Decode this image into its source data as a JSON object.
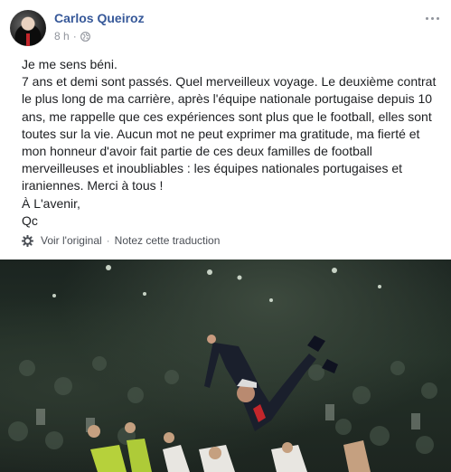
{
  "post": {
    "author": "Carlos Queiroz",
    "time": "8 h",
    "dot": "·",
    "paragraphs": [
      "Je me sens béni.",
      "7 ans et demi sont passés. Quel merveilleux voyage. Le deuxième contrat le plus long de ma carrière, après l'équipe nationale portugaise depuis 10 ans, me rappelle que ces expériences sont plus que le football, elles sont toutes sur la vie. Aucun mot ne peut exprimer ma gratitude, ma fierté et mon honneur d'avoir fait partie de ces deux familles de football merveilleuses et inoubliables : les équipes nationales portugaises et iraniennes. Merci à tous !",
      "À L'avenir,",
      "Qc"
    ],
    "see_original": "Voir l'original",
    "separator": "·",
    "rate_translation": "Notez cette traduction"
  },
  "icons": {
    "privacy": "globe-icon",
    "settings": "gear-icon",
    "more": "more-options-icon"
  },
  "colors": {
    "author_link": "#365899",
    "meta_text": "#90949c",
    "body_text": "#1c1e21"
  }
}
